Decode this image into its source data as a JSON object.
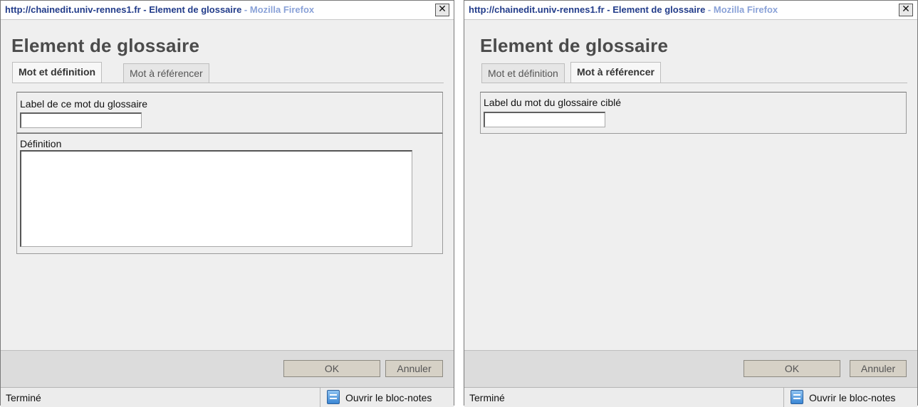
{
  "windows": [
    {
      "title_url": "http://chainedit.univ-rennes1.fr",
      "title_sep": " - ",
      "title_page": "Element de glossaire",
      "title_app": " - Mozilla Firefox",
      "close_glyph": "✕",
      "heading": "Element de glossaire",
      "tabs": [
        {
          "label": "Mot et définition",
          "active": true
        },
        {
          "label": "Mot à référencer",
          "active": false
        }
      ],
      "fields": {
        "label_field_label": "Label de ce mot du glossaire",
        "label_field_value": "",
        "definition_label": "Définition",
        "definition_value": ""
      },
      "buttons": {
        "ok": "OK",
        "cancel": "Annuler"
      },
      "status": {
        "text": "Terminé",
        "notes_icon": "notepad-icon",
        "notes_label": "Ouvrir le bloc-notes"
      }
    },
    {
      "title_url": "http://chainedit.univ-rennes1.fr",
      "title_sep": " - ",
      "title_page": "Element de glossaire",
      "title_app": " - Mozilla Firefox",
      "close_glyph": "✕",
      "heading": "Element de glossaire",
      "tabs": [
        {
          "label": "Mot et définition",
          "active": false
        },
        {
          "label": "Mot à référencer",
          "active": true
        }
      ],
      "fields": {
        "target_field_label": "Label du mot du glossaire ciblé",
        "target_field_value": ""
      },
      "buttons": {
        "ok": "OK",
        "cancel": "Annuler"
      },
      "status": {
        "text": "Terminé",
        "notes_icon": "notepad-icon",
        "notes_label": "Ouvrir le bloc-notes"
      }
    }
  ]
}
